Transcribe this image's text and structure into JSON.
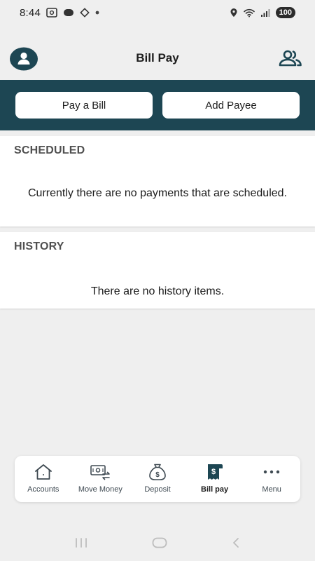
{
  "status_bar": {
    "time": "8:44",
    "battery": "100"
  },
  "header": {
    "title": "Bill Pay"
  },
  "actions": {
    "pay_bill_label": "Pay a Bill",
    "add_payee_label": "Add Payee"
  },
  "scheduled": {
    "heading": "SCHEDULED",
    "empty_message": "Currently there are no payments that are scheduled."
  },
  "history": {
    "heading": "HISTORY",
    "empty_message": "There are no history items."
  },
  "bottom_nav": {
    "items": [
      {
        "label": "Accounts",
        "icon": "house-icon"
      },
      {
        "label": "Move Money",
        "icon": "transfer-icon"
      },
      {
        "label": "Deposit",
        "icon": "money-bag-icon"
      },
      {
        "label": "Bill pay",
        "icon": "bill-icon",
        "active": true
      },
      {
        "label": "Menu",
        "icon": "more-dots-icon"
      }
    ]
  },
  "colors": {
    "brand_dark": "#1d4653",
    "background": "#efefef",
    "card": "#ffffff"
  }
}
